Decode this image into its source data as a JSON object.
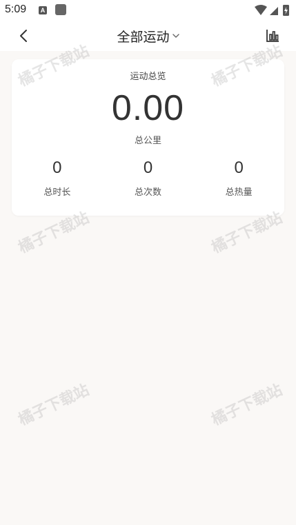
{
  "status_bar": {
    "time": "5:09",
    "app_icon_letter": "A",
    "icons": [
      "app-notification-icon",
      "square-notification-icon",
      "wifi-icon",
      "signal-icon",
      "battery-charging-icon"
    ]
  },
  "nav": {
    "title": "全部运动",
    "back_icon": "chevron-left-icon",
    "dropdown_icon": "chevron-down-icon",
    "chart_icon": "bar-chart-icon"
  },
  "summary": {
    "title": "运动总览",
    "total_km_value": "0.00",
    "total_km_label": "总公里",
    "stats": [
      {
        "value": "0",
        "label": "总时长"
      },
      {
        "value": "0",
        "label": "总次数"
      },
      {
        "value": "0",
        "label": "总热量"
      }
    ]
  },
  "watermark_text": "橘子下载站",
  "colors": {
    "background": "#faf8f6",
    "card": "#ffffff",
    "text_primary": "#333333"
  }
}
